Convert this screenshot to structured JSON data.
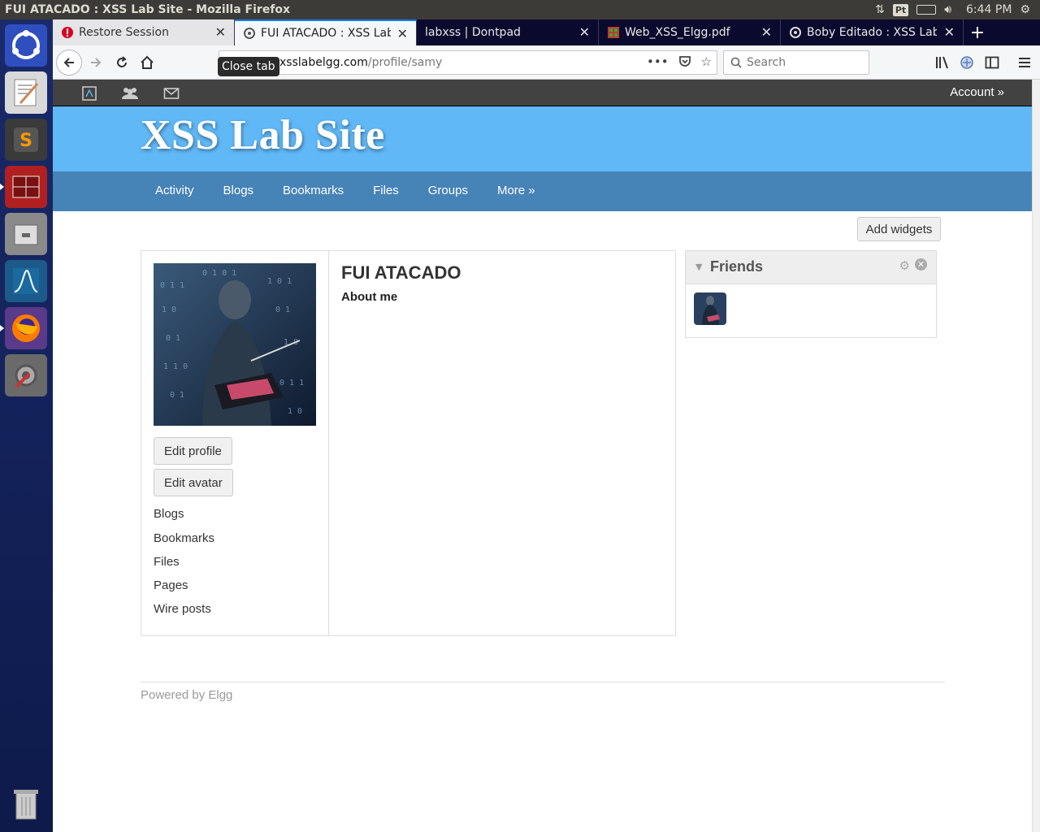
{
  "window": {
    "title": "FUI ATACADO : XSS Lab Site - Mozilla Firefox"
  },
  "panel": {
    "keyboard": "Pt",
    "clock": "6:44 PM"
  },
  "tabs": [
    {
      "label": "Restore Session"
    },
    {
      "label": "FUI ATACADO : XSS Lab Site"
    },
    {
      "label": "labxss | Dontpad"
    },
    {
      "label": "Web_XSS_Elgg.pdf"
    },
    {
      "label": "Boby Editado : XSS Lab Site"
    }
  ],
  "tooltip": "Close tab",
  "url": {
    "host": "xsslabelgg.com",
    "path": "/profile/samy"
  },
  "search": {
    "placeholder": "Search"
  },
  "topbar": {
    "account": "Account"
  },
  "site": {
    "name": "XSS Lab Site"
  },
  "menu": [
    "Activity",
    "Blogs",
    "Bookmarks",
    "Files",
    "Groups",
    "More"
  ],
  "add_widgets": "Add widgets",
  "profile": {
    "name": "FUI ATACADO",
    "about_label": "About me",
    "edit_profile": "Edit profile",
    "edit_avatar": "Edit avatar",
    "links": [
      "Blogs",
      "Bookmarks",
      "Files",
      "Pages",
      "Wire posts"
    ]
  },
  "friends_widget": {
    "title": "Friends"
  },
  "footer": {
    "text": "Powered by Elgg"
  },
  "colors": {
    "header": "#60b8f7",
    "menu": "#4683b6",
    "topbar": "#424242",
    "launcher": "#1a2a6a"
  }
}
